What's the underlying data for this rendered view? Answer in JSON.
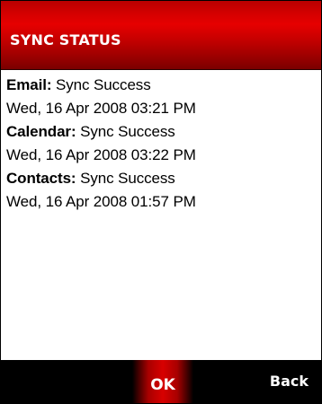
{
  "header": {
    "title": "SYNC STATUS"
  },
  "sync_items": [
    {
      "label": "Email:",
      "status": " Sync Success",
      "timestamp": "Wed, 16 Apr 2008 03:21 PM"
    },
    {
      "label": "Calendar:",
      "status": " Sync Success",
      "timestamp": "Wed, 16 Apr 2008 03:22 PM"
    },
    {
      "label": "Contacts:",
      "status": " Sync Success",
      "timestamp": "Wed, 16 Apr 2008 01:57 PM"
    }
  ],
  "softkeys": {
    "center_label": "OK",
    "right_label": "Back"
  },
  "colors": {
    "title_bar": "#d40000",
    "softkey_bar": "#000000",
    "ok_highlight": "#d80000",
    "text": "#000000",
    "background": "#ffffff"
  }
}
